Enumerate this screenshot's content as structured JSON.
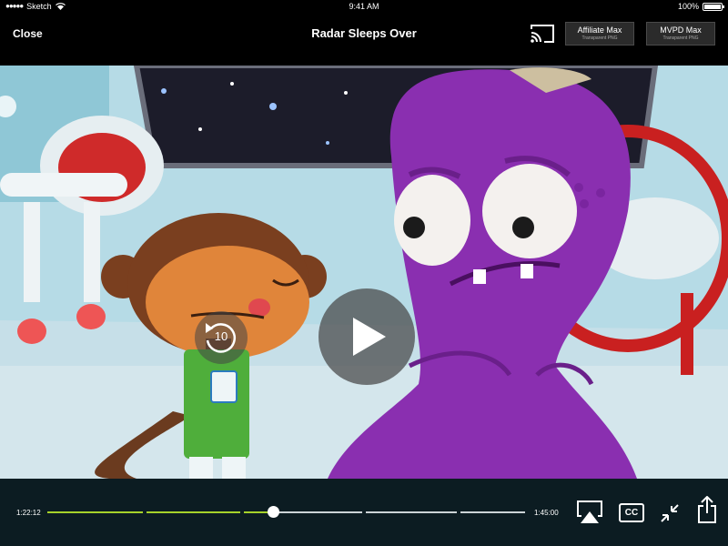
{
  "status_bar": {
    "carrier": "Sketch",
    "time": "9:41 AM",
    "battery": "100%"
  },
  "header": {
    "close_label": "Close",
    "title": "Radar Sleeps Over",
    "cast_icon": "cast-icon",
    "logos": [
      {
        "label": "Affiliate Max",
        "sublabel": "Transparent PNG"
      },
      {
        "label": "MVPD Max",
        "sublabel": "Transparent PNG"
      }
    ]
  },
  "player": {
    "rewind_seconds": "10",
    "play_icon": "play-icon",
    "rewind_icon": "rewind-icon",
    "current_time": "1:22:12",
    "total_time": "1:45:00",
    "progress_fraction": 0.47,
    "colors": {
      "played": "#a6d22a",
      "remaining": "#ccd3d6",
      "control_bar_bg": "#0c1c22"
    },
    "buttons": {
      "airplay_icon": "airplay-icon",
      "cc_label": "CC",
      "minimize_icon": "minimize-icon",
      "share_icon": "share-icon"
    }
  }
}
